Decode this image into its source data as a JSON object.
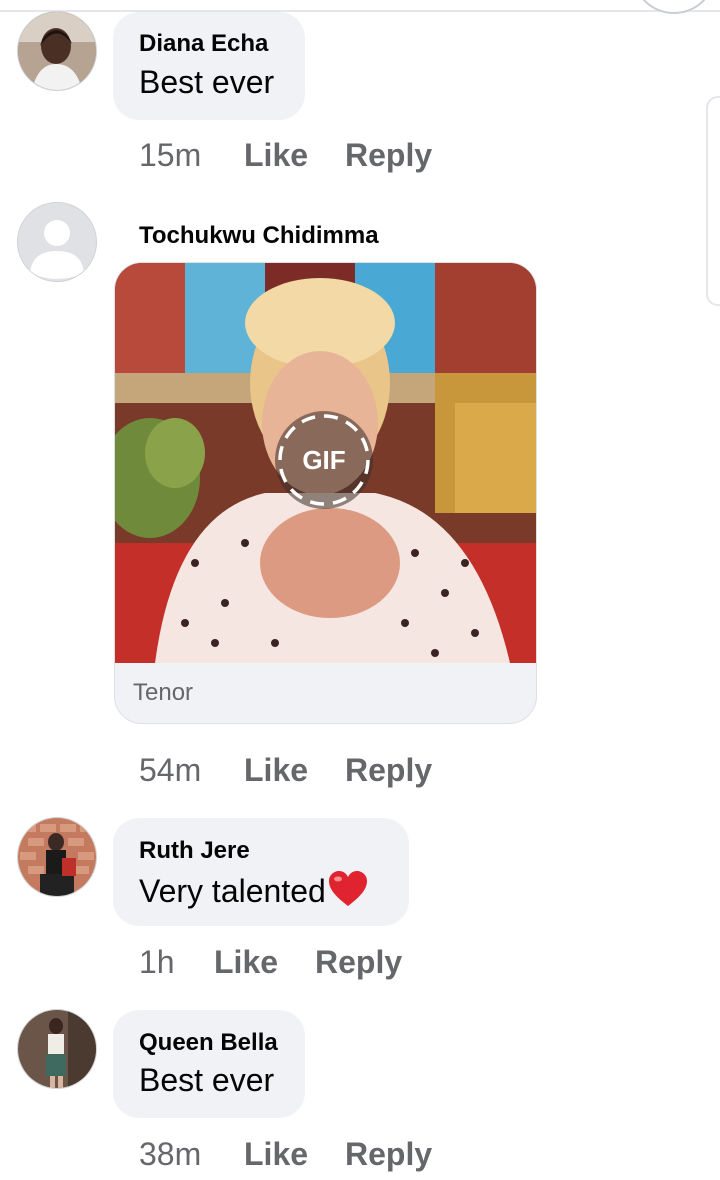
{
  "comments": [
    {
      "author": "Diana Echa",
      "text": "Best ever",
      "time": "15m",
      "like": "Like",
      "reply": "Reply"
    },
    {
      "author": "Tochukwu Chidimma",
      "gif": {
        "badge": "GIF",
        "source": "Tenor"
      },
      "time": "54m",
      "like": "Like",
      "reply": "Reply"
    },
    {
      "author": "Ruth Jere",
      "text": "Very talented",
      "emoji": "heart-emoji",
      "time": "1h",
      "like": "Like",
      "reply": "Reply"
    },
    {
      "author": "Queen Bella",
      "text": "Best ever",
      "time": "38m",
      "like": "Like",
      "reply": "Reply"
    }
  ],
  "colors": {
    "bubble": "#f0f2f5",
    "meta_text": "#65676b",
    "body_text": "#050505",
    "heart": "#e0242f"
  }
}
